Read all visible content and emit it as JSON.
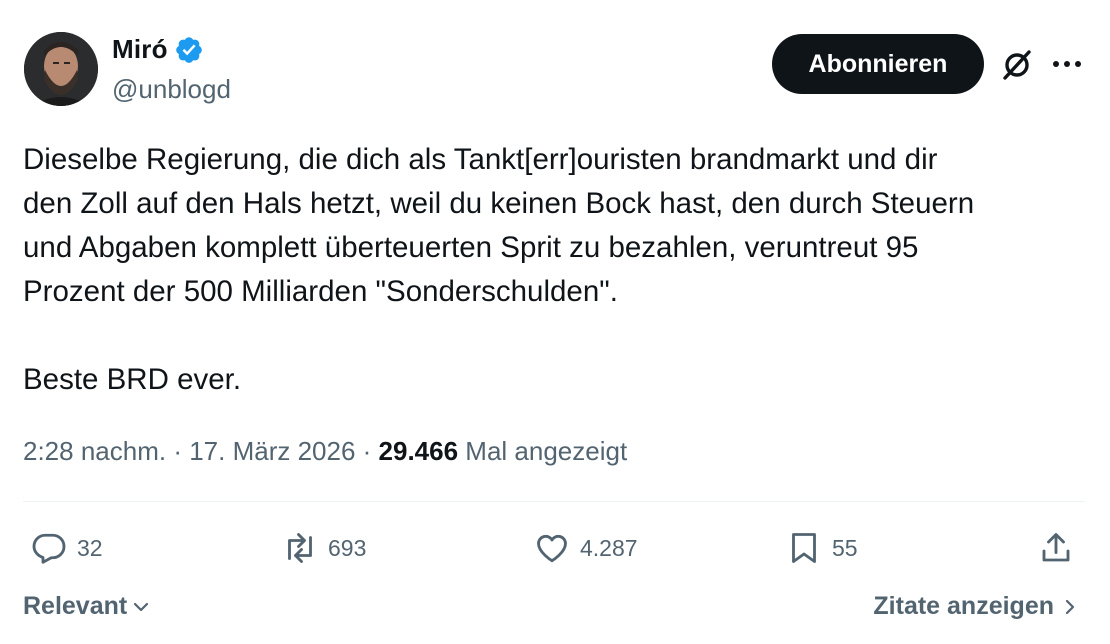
{
  "author": {
    "name": "Miró",
    "handle": "@unblogd",
    "verified_color": "#1d9bf0"
  },
  "header": {
    "follow_label": "Abonnieren"
  },
  "tweet": {
    "text": "Dieselbe Regierung, die dich als Tankt[err]ouristen brandmarkt und dir\nden Zoll auf den Hals hetzt, weil du keinen Bock hast, den durch Steuern\nund Abgaben komplett überteuerten Sprit zu bezahlen, veruntreut 95\nProzent der 500 Milliarden \"Sonderschulden\".\n\nBeste BRD ever.",
    "time": "2:28 nachm.",
    "separator": " · ",
    "date": "17. März 2026",
    "views_count": "29.466",
    "views_label": "Mal angezeigt"
  },
  "actions": {
    "replies": "32",
    "reposts": "693",
    "likes": "4.287",
    "bookmarks": "55"
  },
  "footer": {
    "sort_label": "Relevant",
    "quotes_label": "Zitate anzeigen"
  },
  "icons": {
    "verified": "verified-badge-icon",
    "grok": "grok-icon",
    "more": "more-dots-icon",
    "reply": "reply-icon",
    "repost": "repost-icon",
    "like": "heart-icon",
    "bookmark": "bookmark-icon",
    "share": "share-icon"
  }
}
